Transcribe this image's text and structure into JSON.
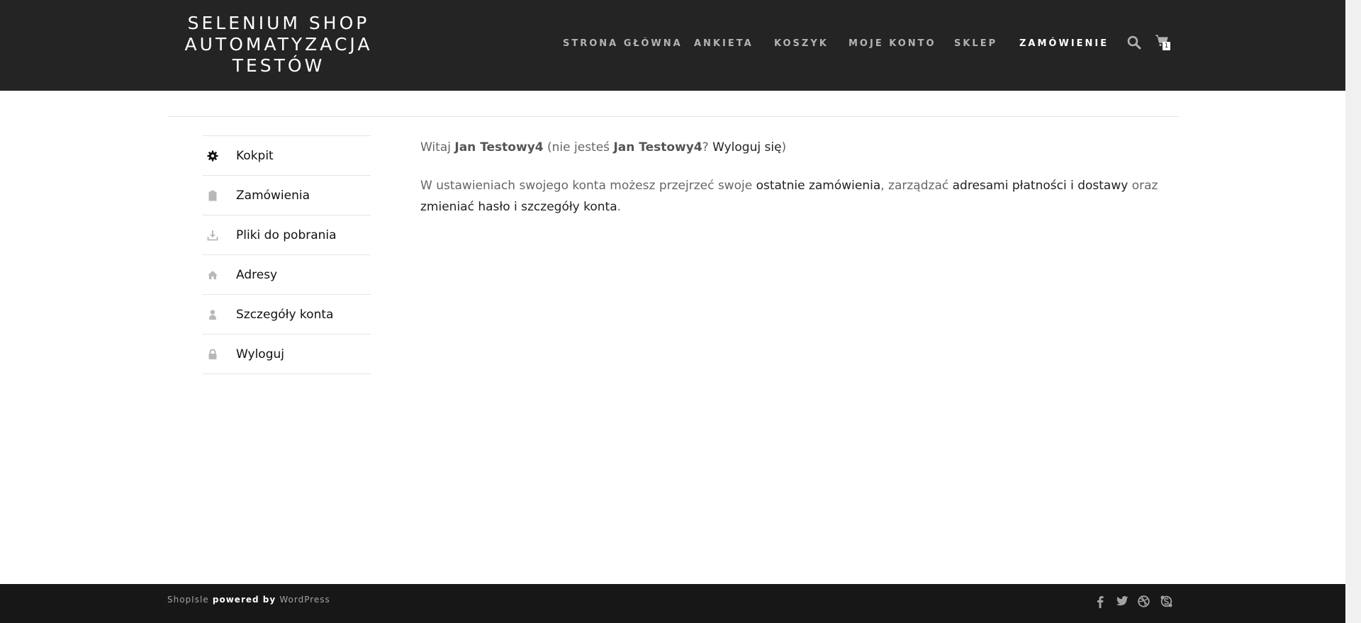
{
  "site": {
    "logo_lines": [
      "SELENIUM SHOP",
      "AUTOMATYZACJA",
      "TESTÓW"
    ]
  },
  "nav": {
    "items": [
      "STRONA GŁÓWNA",
      "ANKIETA",
      "KOSZYK",
      "MOJE KONTO",
      "SKLEP",
      "ZAMÓWIENIE"
    ],
    "active_index": 5,
    "search_icon": "search-icon",
    "cart_icon": "cart-icon",
    "cart_count": "1"
  },
  "account_menu": {
    "items": [
      {
        "label": "Kokpit",
        "icon": "gear-icon"
      },
      {
        "label": "Zamówienia",
        "icon": "clipboard-icon"
      },
      {
        "label": "Pliki do pobrania",
        "icon": "download-icon"
      },
      {
        "label": "Adresy",
        "icon": "home-icon"
      },
      {
        "label": "Szczegóły konta",
        "icon": "user-icon"
      },
      {
        "label": "Wyloguj",
        "icon": "lock-icon"
      }
    ]
  },
  "dashboard": {
    "greeting_prefix": "Witaj ",
    "user_name": "Jan Testowy4",
    "not_you_prefix": " (nie jesteś ",
    "not_you_name": "Jan Testowy4",
    "not_you_q": "? ",
    "logout_link": "Wyloguj się",
    "not_you_suffix": ")",
    "desc_1": "W ustawieniach swojego konta możesz przejrzeć swoje ",
    "link_orders": "ostatnie zamówienia",
    "desc_2": ", zarządzać ",
    "link_addresses": "adresami płatności i dostawy",
    "desc_3": " oraz ",
    "link_account": "zmieniać hasło i szczegóły konta",
    "desc_4": "."
  },
  "footer": {
    "brand": "ShopIsle",
    "powered": " powered by ",
    "wp": "WordPress",
    "social_icons": [
      "facebook-icon",
      "twitter-icon",
      "dribbble-icon",
      "skype-icon"
    ]
  },
  "colors": {
    "header_bg": "#242424",
    "footer_bg": "#171717",
    "nav_active": "#ffffff",
    "nav_inactive": "#b3b3b3"
  }
}
